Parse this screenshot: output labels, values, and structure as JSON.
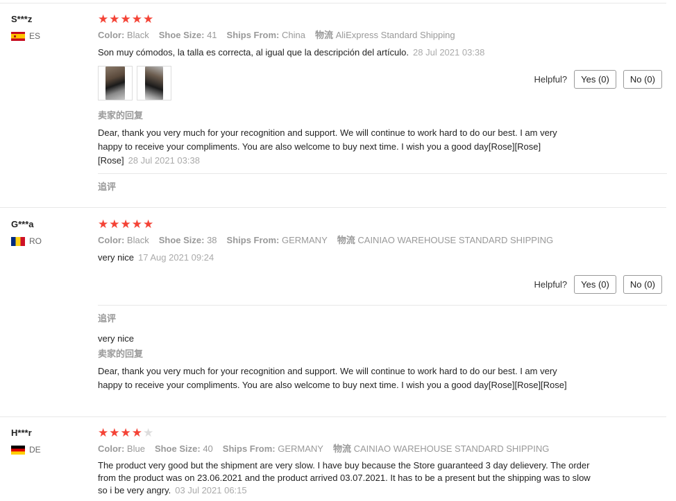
{
  "labels": {
    "color": "Color:",
    "shoe_size": "Shoe Size:",
    "ships_from": "Ships From:",
    "logistics": "物流",
    "helpful": "Helpful?",
    "seller_reply": "卖家的回复",
    "additional": "追评"
  },
  "reviews": [
    {
      "user": "S***z",
      "country": "ES",
      "rating": 5,
      "color": "Black",
      "shoe_size": "41",
      "ships_from": "China",
      "logistics": "AliExpress Standard Shipping",
      "text": "Son muy cómodos, la talla es correcta, al igual que la descripción del artículo.",
      "date": "28 Jul 2021 03:38",
      "yes": "Yes (0)",
      "no": "No (0)",
      "reply": "Dear, thank you very much for your recognition and support. We will continue to work hard to do our best. I am very happy to receive your compliments. You are also welcome to buy next time. I wish you a good day[Rose][Rose][Rose]",
      "reply_date": "28 Jul 2021 03:38"
    },
    {
      "user": "G***a",
      "country": "RO",
      "rating": 5,
      "color": "Black",
      "shoe_size": "38",
      "ships_from": "GERMANY",
      "logistics": "CAINIAO WAREHOUSE STANDARD SHIPPING",
      "text": "very nice",
      "date": "17 Aug 2021 09:24",
      "yes": "Yes (0)",
      "no": "No (0)",
      "followup": "very nice",
      "reply": "Dear, thank you very much for your recognition and support. We will continue to work hard to do our best. I am very happy to receive your compliments. You are also welcome to buy next time. I wish you a good day[Rose][Rose][Rose]"
    },
    {
      "user": "H***r",
      "country": "DE",
      "rating": 4,
      "color": "Blue",
      "shoe_size": "40",
      "ships_from": "GERMANY",
      "logistics": "CAINIAO WAREHOUSE STANDARD SHIPPING",
      "text": "The product very good but the shipment are very slow. I have buy because the Store guaranteed 3 day delievery. The order from the product was on 23.06.2021 and the product arrived 03.07.2021. It has to be a present but the shipping was to slow so i be very angry.",
      "date": "03 Jul 2021 06:15"
    }
  ]
}
